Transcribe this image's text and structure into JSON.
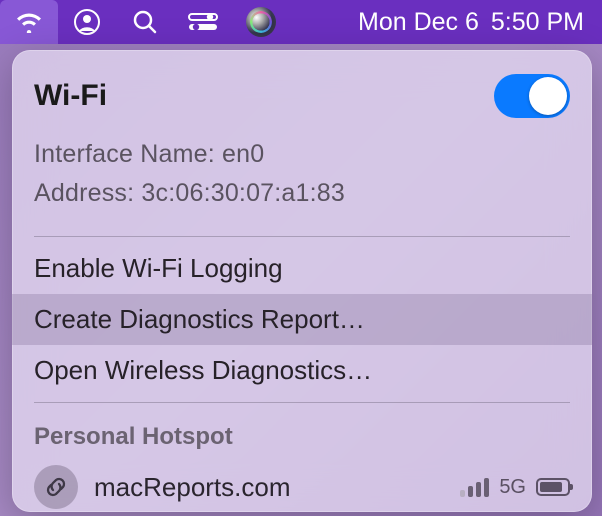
{
  "menubar": {
    "date": "Mon Dec 6",
    "time": "5:50 PM"
  },
  "panel": {
    "title": "Wi-Fi",
    "wifi_enabled": true,
    "interface_label": "Interface Name:",
    "interface_value": "en0",
    "address_label": "Address:",
    "address_value": "3c:06:30:07:a1:83",
    "actions": {
      "logging": "Enable Wi-Fi Logging",
      "diagnostics_report": "Create Diagnostics Report…",
      "wireless_diagnostics": "Open Wireless Diagnostics…"
    },
    "hotspot_section": "Personal Hotspot",
    "hotspot": {
      "name": "macReports.com",
      "network_type": "5G"
    }
  }
}
